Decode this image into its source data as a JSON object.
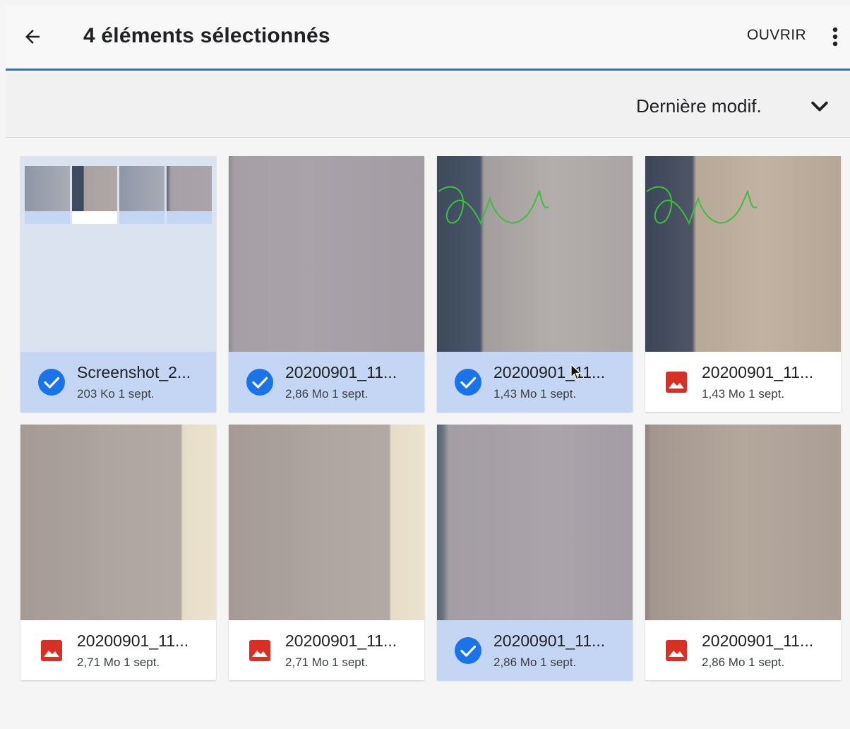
{
  "header": {
    "title": "4 éléments sélectionnés",
    "open_label": "OUVRIR"
  },
  "sort": {
    "label": "Dernière modif."
  },
  "colors": {
    "accent": "#1a73e8",
    "selected_bg": "#c4d6f4",
    "image_icon": "#d93025"
  },
  "files": [
    {
      "name": "Screenshot_2...",
      "meta": "203 Ko 1 sept.",
      "selected": true,
      "icon": "check-circle-icon"
    },
    {
      "name": "20200901_11...",
      "meta": "2,86 Mo 1 sept.",
      "selected": true,
      "icon": "check-circle-icon"
    },
    {
      "name": "20200901_11...",
      "meta": "1,43 Mo 1 sept.",
      "selected": true,
      "icon": "check-circle-icon"
    },
    {
      "name": "20200901_11...",
      "meta": "1,43 Mo 1 sept.",
      "selected": false,
      "icon": "image-file-icon"
    },
    {
      "name": "20200901_11...",
      "meta": "2,71 Mo 1 sept.",
      "selected": false,
      "icon": "image-file-icon"
    },
    {
      "name": "20200901_11...",
      "meta": "2,71 Mo 1 sept.",
      "selected": false,
      "icon": "image-file-icon"
    },
    {
      "name": "20200901_11...",
      "meta": "2,86 Mo 1 sept.",
      "selected": true,
      "icon": "check-circle-icon"
    },
    {
      "name": "20200901_11...",
      "meta": "2,86 Mo 1 sept.",
      "selected": false,
      "icon": "image-file-icon"
    }
  ]
}
